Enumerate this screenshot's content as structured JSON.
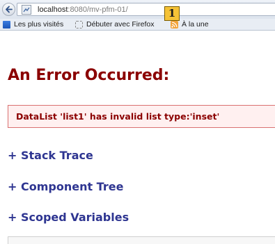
{
  "browser": {
    "url_host": "localhost",
    "url_rest": ":8080/mv-pfm-01/",
    "annotation_label": "1",
    "icons": {
      "back": "back-arrow-icon",
      "site": "site-identity-icon"
    }
  },
  "bookmarks_bar": {
    "items": [
      {
        "label": "Les plus visités",
        "icon": "most-visited-icon"
      },
      {
        "label": "Débuter avec Firefox",
        "icon": "page-icon"
      },
      {
        "label": "À la une",
        "icon": "rss-feed-icon"
      }
    ]
  },
  "page": {
    "title": "An Error Occurred:",
    "error_message": "DataList 'list1' has invalid list type:'inset'",
    "sections": [
      {
        "label": "+ Stack Trace"
      },
      {
        "label": "+ Component Tree"
      },
      {
        "label": "+ Scoped Variables"
      }
    ]
  },
  "colors": {
    "error_red": "#8b0000",
    "error_box_bg": "#fff0f0",
    "error_box_border": "#d97070",
    "link_blue": "#2e3591",
    "annotation_badge": "#f5c236"
  }
}
